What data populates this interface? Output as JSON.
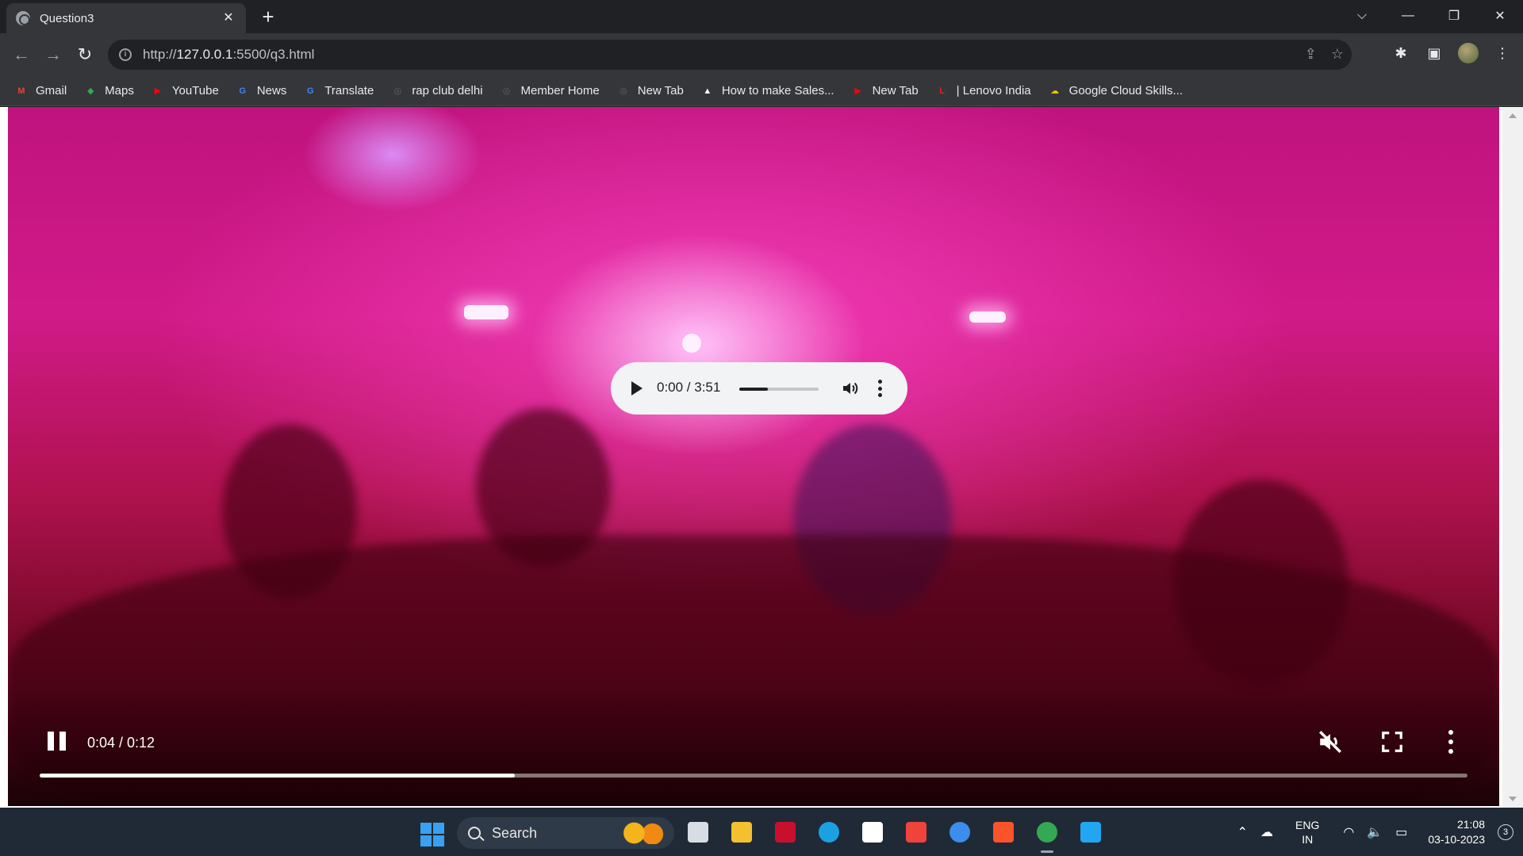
{
  "browser": {
    "tab_title": "Question3",
    "tab_close": "✕",
    "new_tab": "+",
    "window_controls": {
      "tab_search": "⌵",
      "minimize": "—",
      "restore": "❐",
      "close": "✕"
    },
    "nav": {
      "back": "←",
      "forward": "→",
      "reload": "↻"
    },
    "url": {
      "prefix": "http://",
      "host": "127.0.0.1",
      "rest": ":5500/q3.html"
    },
    "omnibox_icons": {
      "share": "⇪",
      "bookmark": "☆"
    },
    "toolbar_icons": {
      "extensions": "✱",
      "side_panel": "▣",
      "menu": "⋮"
    }
  },
  "bookmarks": [
    {
      "label": "Gmail",
      "icon": "gmail-icon",
      "color": "#ea4335",
      "glyph": "M"
    },
    {
      "label": "Maps",
      "icon": "maps-icon",
      "color": "#34a853",
      "glyph": "◆"
    },
    {
      "label": "YouTube",
      "icon": "youtube-icon",
      "color": "#ff0000",
      "glyph": "▶"
    },
    {
      "label": "News",
      "icon": "news-icon",
      "color": "#4285f4",
      "glyph": "G"
    },
    {
      "label": "Translate",
      "icon": "translate-icon",
      "color": "#4285f4",
      "glyph": "G"
    },
    {
      "label": "rap club delhi",
      "icon": "globe-icon",
      "color": "#5f6368",
      "glyph": "◎"
    },
    {
      "label": "Member Home",
      "icon": "globe-icon",
      "color": "#5f6368",
      "glyph": "◎"
    },
    {
      "label": "New Tab",
      "icon": "globe-icon",
      "color": "#5f6368",
      "glyph": "◎"
    },
    {
      "label": "How to make Sales...",
      "icon": "chart-icon",
      "color": "#ffffff",
      "glyph": "▲"
    },
    {
      "label": "New Tab",
      "icon": "youtube-icon",
      "color": "#ff0000",
      "glyph": "▶"
    },
    {
      "label": "| Lenovo India",
      "icon": "lenovo-icon",
      "color": "#e2231a",
      "glyph": "L"
    },
    {
      "label": "Google Cloud Skills...",
      "icon": "cloud-icon",
      "color": "#fbbc04",
      "glyph": "☁"
    }
  ],
  "video": {
    "time": "0:04 / 0:12",
    "progress": 0.333,
    "muted": true
  },
  "audio": {
    "time": "0:00 / 3:51",
    "volume_level": 0.36
  },
  "taskbar": {
    "search_label": "Search",
    "apps": [
      {
        "name": "task-view-icon",
        "color": "#d8dde3"
      },
      {
        "name": "file-explorer-icon",
        "color": "#f5c030"
      },
      {
        "name": "mcafee-icon",
        "color": "#c8102e"
      },
      {
        "name": "edge-icon",
        "color": "#1ba1e2"
      },
      {
        "name": "store-icon",
        "color": "#ffffff"
      },
      {
        "name": "anydesk-icon",
        "color": "#ef443b"
      },
      {
        "name": "help-icon",
        "color": "#3b8eea"
      },
      {
        "name": "brave-icon",
        "color": "#fb542b"
      },
      {
        "name": "chrome-icon",
        "color": "#34a853"
      },
      {
        "name": "vscode-icon",
        "color": "#23a6f2"
      }
    ],
    "lang_top": "ENG",
    "lang_bottom": "IN",
    "time": "21:08",
    "date": "03-10-2023",
    "notifications": "3"
  }
}
